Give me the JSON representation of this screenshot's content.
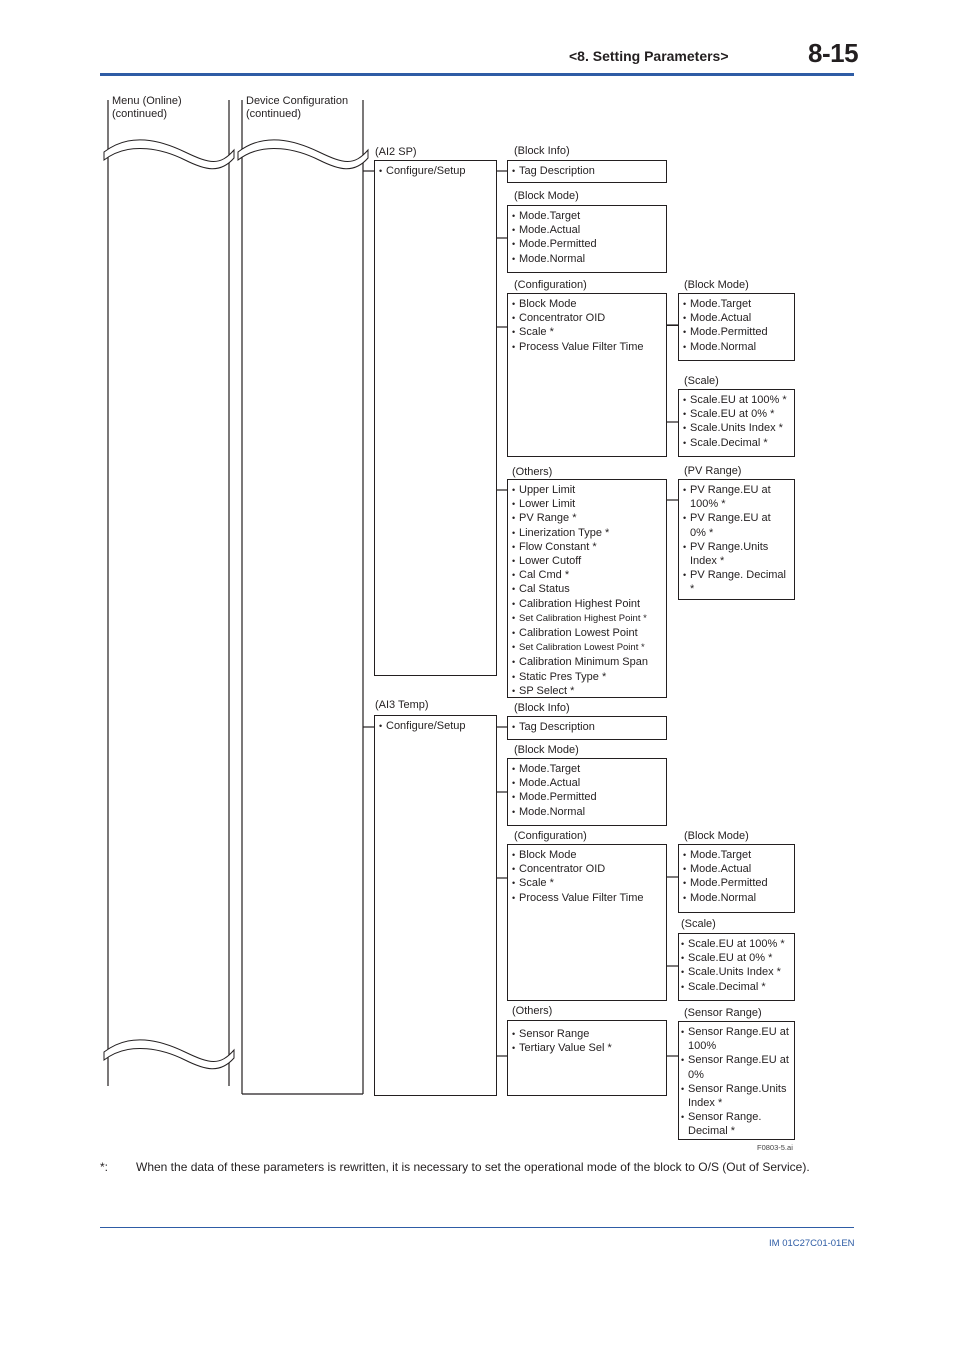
{
  "header": {
    "section": "<8.  Setting Parameters>",
    "page_number": "8-15"
  },
  "columns": {
    "menu": {
      "label_line1": "Menu (Online)",
      "label_line2": "(continued)"
    },
    "device_config": {
      "label_line1": "Device Configuration",
      "label_line2": "(continued)"
    }
  },
  "ai2": {
    "label": "(AI2 SP)",
    "items": [
      "Configure/Setup"
    ],
    "block_info": {
      "label": "(Block Info)",
      "items": [
        "Tag Description"
      ]
    },
    "block_mode": {
      "label": "(Block Mode)",
      "items": [
        "Mode.Target",
        "Mode.Actual",
        "Mode.Permitted",
        "Mode.Normal"
      ]
    },
    "configuration": {
      "label": "(Configuration)",
      "items": [
        "Block Mode",
        "Concentrator OID",
        "Scale *",
        "Process Value Filter Time"
      ],
      "block_mode": {
        "label": "(Block Mode)",
        "items": [
          "Mode.Target",
          "Mode.Actual",
          "Mode.Permitted",
          "Mode.Normal"
        ]
      },
      "scale": {
        "label": "(Scale)",
        "items": [
          "Scale.EU at 100% *",
          "Scale.EU at 0% *",
          "Scale.Units Index *",
          "Scale.Decimal *"
        ]
      }
    },
    "others": {
      "label": "(Others)",
      "items": [
        "Upper Limit",
        "Lower Limit",
        "PV Range *",
        "Linerization Type *",
        "Flow Constant *",
        "Lower Cutoff",
        "Cal Cmd *",
        "Cal Status",
        "Calibration Highest Point",
        "Set Calibration Highest Point *",
        "Calibration Lowest Point",
        "Set Calibration Lowest Point *",
        "Calibration Minimum Span",
        "Static Pres Type *",
        "SP Select *"
      ],
      "pv_range": {
        "label": "(PV Range)",
        "items": [
          "PV Range.EU at 100% *",
          "PV Range.EU at 0% *",
          "PV Range.Units Index *",
          "PV Range. Decimal *"
        ]
      }
    }
  },
  "ai3": {
    "label": "(AI3 Temp)",
    "items": [
      "Configure/Setup"
    ],
    "block_info": {
      "label": "(Block Info)",
      "items": [
        "Tag Description"
      ]
    },
    "block_mode": {
      "label": "(Block Mode)",
      "items": [
        "Mode.Target",
        "Mode.Actual",
        "Mode.Permitted",
        "Mode.Normal"
      ]
    },
    "configuration": {
      "label": "(Configuration)",
      "items": [
        "Block Mode",
        "Concentrator OID",
        "Scale *",
        "Process Value Filter Time"
      ],
      "block_mode": {
        "label": "(Block Mode)",
        "items": [
          "Mode.Target",
          "Mode.Actual",
          "Mode.Permitted",
          "Mode.Normal"
        ]
      },
      "scale": {
        "label": "(Scale)",
        "items": [
          "Scale.EU at 100% *",
          "Scale.EU at 0% *",
          "Scale.Units Index *",
          "Scale.Decimal *"
        ]
      }
    },
    "others": {
      "label": "(Others)",
      "items": [
        "Sensor Range",
        "Tertiary Value Sel *"
      ],
      "sensor_range": {
        "label": "(Sensor Range)",
        "items": [
          "Sensor Range.EU at  100%",
          "Sensor Range.EU at  0%",
          "Sensor Range.Units Index *",
          "Sensor Range. Decimal *"
        ]
      }
    }
  },
  "figure_id": "F0803-5.ai",
  "footnote": {
    "mark": "*:",
    "text": "When the data of these parameters is rewritten, it is necessary to set the operational mode of the block to O/S (Out of Service)."
  },
  "footer": {
    "doc_id": "IM 01C27C01-01EN"
  },
  "colors": {
    "accent": "#2e5ca5",
    "ink": "#231f20"
  }
}
